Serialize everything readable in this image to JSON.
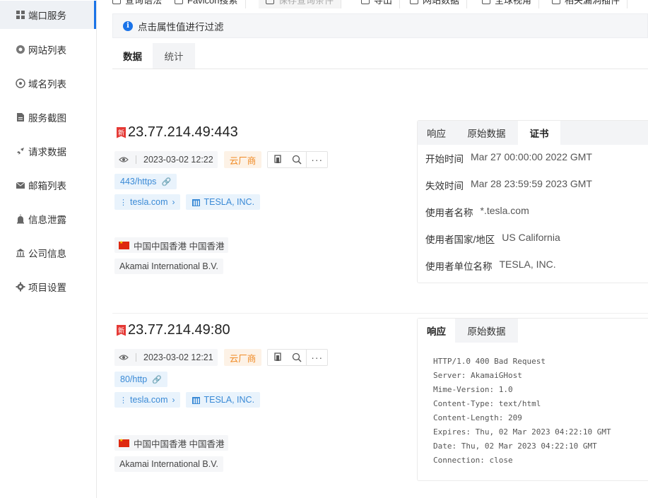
{
  "sidebar": {
    "items": [
      {
        "label": "端口服务",
        "icon": "grid-icon",
        "active": true
      },
      {
        "label": "网站列表",
        "icon": "globe-icon"
      },
      {
        "label": "域名列表",
        "icon": "domain-icon"
      },
      {
        "label": "服务截图",
        "icon": "file-icon"
      },
      {
        "label": "请求数据",
        "icon": "rocket-icon"
      },
      {
        "label": "邮箱列表",
        "icon": "mail-icon"
      },
      {
        "label": "信息泄露",
        "icon": "alert-icon"
      },
      {
        "label": "公司信息",
        "icon": "bank-icon"
      },
      {
        "label": "项目设置",
        "icon": "gear-icon"
      }
    ]
  },
  "toolbar": {
    "items": [
      "查询语法",
      "Favicon搜索",
      "保存查询条件",
      "导出",
      "网站数据",
      "全球视角",
      "相关漏洞插件"
    ]
  },
  "infobar": {
    "text": "点击属性值进行过滤"
  },
  "tabs": {
    "data": "数据",
    "stats": "统计"
  },
  "records": [
    {
      "ip": "23.77.214.49:443",
      "flag": "新",
      "date": "2023-03-02 12:22",
      "cloud": "云厂商",
      "port": "443/https",
      "domain": "tesla.com",
      "org": "TESLA, INC.",
      "location": "中国中国香港 中国香港",
      "isp": "Akamai International B.V.",
      "panel_tabs": [
        "响应",
        "原始数据",
        "证书"
      ],
      "panel_selected": "证书",
      "cert": [
        {
          "k": "开始时间",
          "v": "Mar 27 00:00:00 2022 GMT"
        },
        {
          "k": "失效时间",
          "v": "Mar 28 23:59:59 2023 GMT"
        },
        {
          "k": "使用者名称",
          "v": "*.tesla.com"
        },
        {
          "k": "使用者国家/地区",
          "v": "US California"
        },
        {
          "k": "使用者单位名称",
          "v": "TESLA, INC."
        }
      ]
    },
    {
      "ip": "23.77.214.49:80",
      "flag": "新",
      "date": "2023-03-02 12:21",
      "cloud": "云厂商",
      "port": "80/http",
      "domain": "tesla.com",
      "org": "TESLA, INC.",
      "location": "中国中国香港 中国香港",
      "isp": "Akamai International B.V.",
      "panel_tabs": [
        "响应",
        "原始数据"
      ],
      "panel_selected": "响应",
      "raw": "HTTP/1.0 400 Bad Request\nServer: AkamaiGHost\nMime-Version: 1.0\nContent-Type: text/html\nContent-Length: 209\nExpires: Thu, 02 Mar 2023 04:22:10 GMT\nDate: Thu, 02 Mar 2023 04:22:10 GMT\nConnection: close"
    }
  ],
  "colors": {
    "accent": "#1a73e8",
    "tag_blue": "#3a8ad6",
    "cloud_orange": "#f08a24",
    "flag_red": "#e53935"
  }
}
